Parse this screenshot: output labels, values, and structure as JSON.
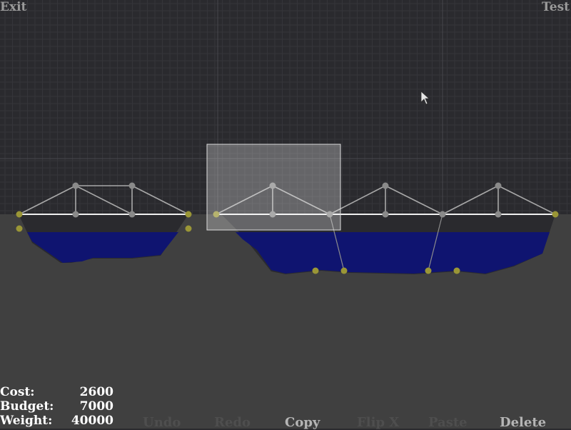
{
  "header": {
    "exit_label": "Exit",
    "test_label": "Test"
  },
  "stats": [
    {
      "label": "Cost:",
      "value": "2600"
    },
    {
      "label": "Budget:",
      "value": "7000"
    },
    {
      "label": "Weight:",
      "value": "40000"
    }
  ],
  "toolbar": [
    {
      "label": "Undo",
      "enabled": false
    },
    {
      "label": "Redo",
      "enabled": false
    },
    {
      "label": "Copy",
      "enabled": true
    },
    {
      "label": "Flip X",
      "enabled": false
    },
    {
      "label": "Paste",
      "enabled": false
    },
    {
      "label": "Delete",
      "enabled": true
    }
  ],
  "colors": {
    "sky": "#2a2a2e",
    "grid_minor": "#35353a",
    "grid_major": "#46464c",
    "ground": "#404040",
    "water": "#0f1470",
    "road": "#f0f0f0",
    "beam": "#a8a8a8",
    "joint": "#8a8a8a",
    "anchor": "#9a9636",
    "selection": "#ffffff"
  },
  "cursor_icon": "arrow-cursor-icon"
}
